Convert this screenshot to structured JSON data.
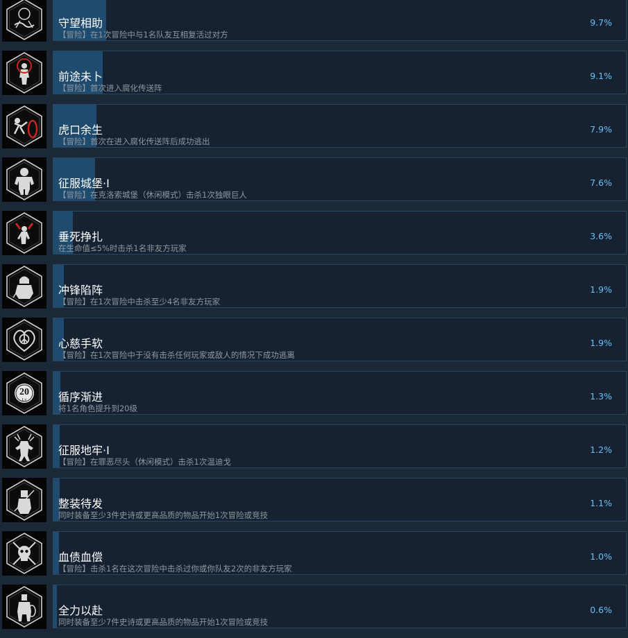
{
  "accent_color": "#66c0f4",
  "bar_color": "#1f4b6e",
  "achievements": [
    {
      "title": "守望相助",
      "description": "【冒险】在1次冒险中与1名队友互相复活过对方",
      "percent_label": "9.7%",
      "percent": 9.7,
      "icon": "revive-hands-icon"
    },
    {
      "title": "前途未卜",
      "description": "【冒险】首次进入腐化传送阵",
      "percent_label": "9.1%",
      "percent": 9.1,
      "icon": "portal-figure-icon"
    },
    {
      "title": "虎口余生",
      "description": "【冒险】首次在进入腐化传送阵后成功逃出",
      "percent_label": "7.9%",
      "percent": 7.9,
      "icon": "escape-portal-icon"
    },
    {
      "title": "征服城堡·I",
      "description": "【冒险】在克洛索城堡（休闲模式）击杀1次独眼巨人",
      "percent_label": "7.6%",
      "percent": 7.6,
      "icon": "cyclops-icon"
    },
    {
      "title": "垂死挣扎",
      "description": "在生命值≤5%时击杀1名非友方玩家",
      "percent_label": "3.6%",
      "percent": 3.6,
      "icon": "dying-fighter-icon"
    },
    {
      "title": "冲锋陷阵",
      "description": "【冒险】在1次冒险中击杀至少4名非友方玩家",
      "percent_label": "1.9%",
      "percent": 1.9,
      "icon": "hooded-warrior-icon"
    },
    {
      "title": "心慈手软",
      "description": "【冒险】在1次冒险中于没有击杀任何玩家或敌人的情况下成功逃离",
      "percent_label": "1.9%",
      "percent": 1.9,
      "icon": "peace-heart-icon"
    },
    {
      "title": "循序渐进",
      "description": "将1名角色提升到20级",
      "percent_label": "1.3%",
      "percent": 1.3,
      "icon": "level-badge-icon",
      "icon_text": "20",
      "icon_subtext": "Lv"
    },
    {
      "title": "征服地牢·I",
      "description": "【冒险】在罪恶尽头（休闲模式）击杀1次温迪戈",
      "percent_label": "1.2%",
      "percent": 1.2,
      "icon": "wendigo-icon"
    },
    {
      "title": "整装待发",
      "description": "同时装备至少3件史诗或更高品质的物品开始1次冒险或竞技",
      "percent_label": "1.1%",
      "percent": 1.1,
      "icon": "armored-knight-icon"
    },
    {
      "title": "血债血偿",
      "description": "【冒险】击杀1名在这次冒险中击杀过你或你队友2次的非友方玩家",
      "percent_label": "1.0%",
      "percent": 1.0,
      "icon": "skull-crossed-swords-icon"
    },
    {
      "title": "全力以赴",
      "description": "同时装备至少7件史诗或更高品质的物品开始1次冒险或竞技",
      "percent_label": "0.6%",
      "percent": 0.6,
      "icon": "full-armor-knight-icon"
    }
  ]
}
